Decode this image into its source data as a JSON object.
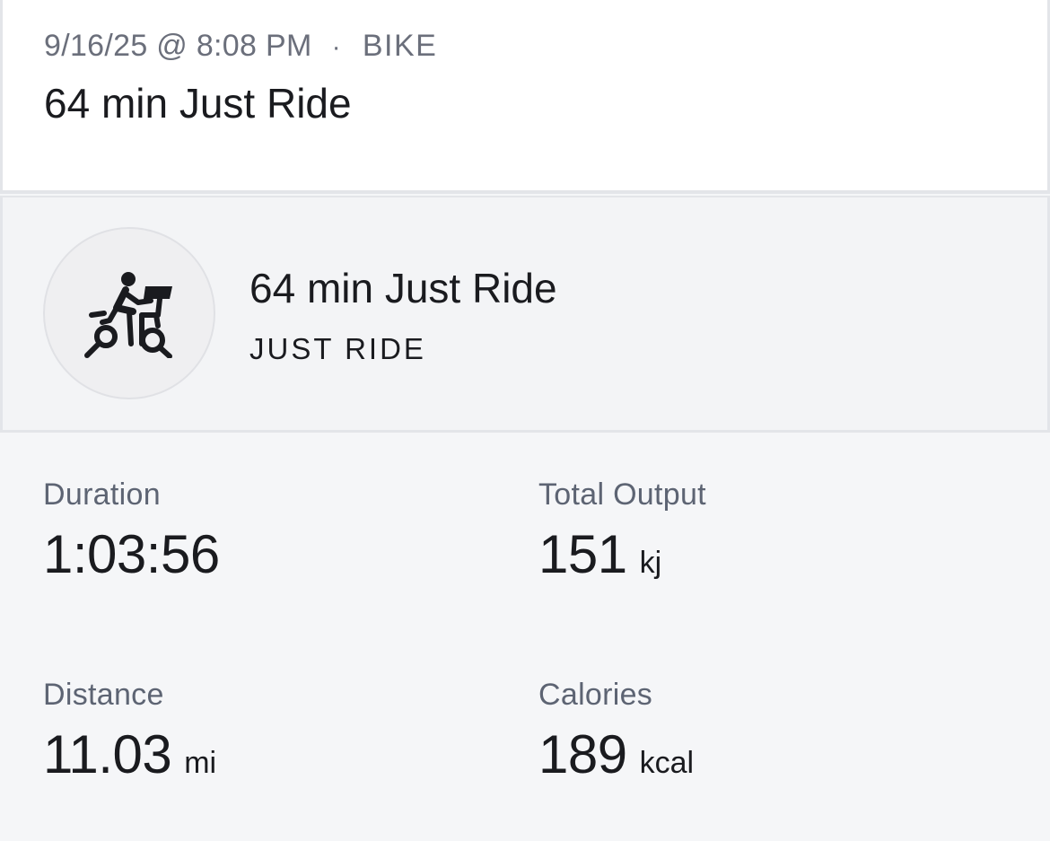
{
  "header": {
    "date": "9/16/25 @ 8:08 PM",
    "separator": "·",
    "type": "BIKE",
    "title": "64 min Just Ride"
  },
  "class_card": {
    "icon": "bike-rider-icon",
    "title": "64 min Just Ride",
    "type": "JUST RIDE"
  },
  "stats": {
    "duration": {
      "label": "Duration",
      "value": "1:03:56",
      "unit": ""
    },
    "total_output": {
      "label": "Total Output",
      "value": "151",
      "unit": "kj"
    },
    "distance": {
      "label": "Distance",
      "value": "11.03",
      "unit": "mi"
    },
    "calories": {
      "label": "Calories",
      "value": "189",
      "unit": "kcal"
    }
  },
  "colors": {
    "text_primary": "#1a1b1f",
    "text_secondary": "#5d6473",
    "background": "#f5f6f8",
    "card": "#ffffff",
    "border": "#e3e5e9"
  }
}
